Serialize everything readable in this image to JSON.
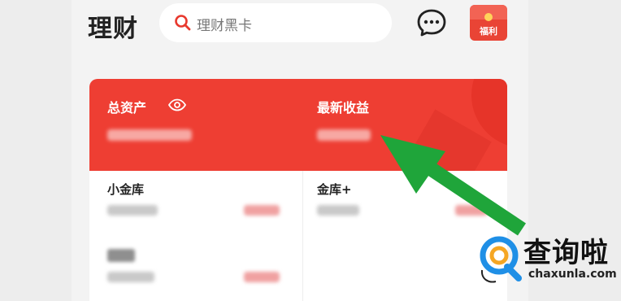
{
  "header": {
    "title": "理财",
    "search_placeholder": "理财黑卡",
    "search_icon": "search-icon",
    "message_icon": "chat-bubble-icon",
    "gift_label": "福利"
  },
  "summary": {
    "total_assets_label": "总资产",
    "eye_icon": "eye-icon",
    "latest_income_label": "最新收益"
  },
  "products": [
    {
      "label": "小金库"
    },
    {
      "label": "金库+"
    }
  ],
  "watermark": {
    "name": "查询啦",
    "url": "chaxunla.com"
  },
  "colors": {
    "brand_red": "#ee3e33",
    "arrow_green": "#1fa53a",
    "watermark_blue": "#1f8fe6",
    "watermark_orange": "#f5a623"
  }
}
